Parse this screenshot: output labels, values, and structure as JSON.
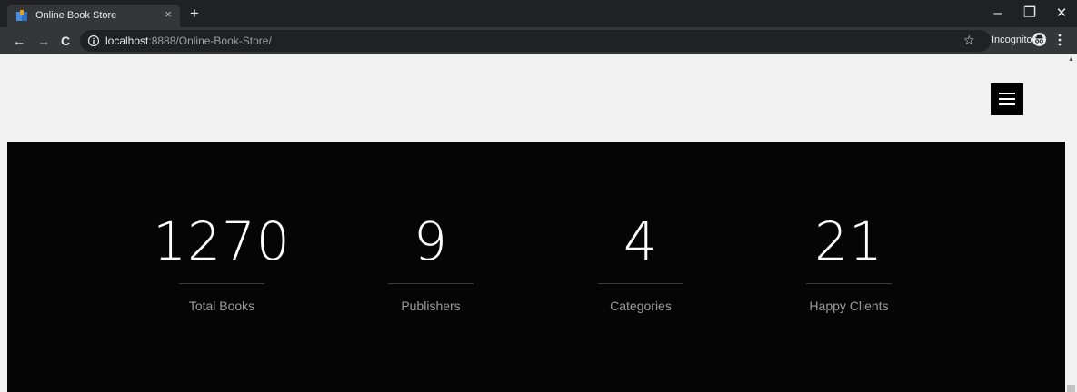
{
  "browser": {
    "tab_title": "Online Book Store",
    "tab_close": "×",
    "new_tab": "+",
    "url_host": "localhost",
    "url_rest": ":8888/Online-Book-Store/",
    "incognito_label": "Incognito",
    "window_controls": {
      "minimize": "–",
      "maximize": "❐",
      "close": "✕"
    },
    "nav": {
      "back": "←",
      "forward": "→",
      "reload": "C"
    },
    "star": "☆",
    "favicon_colors": {
      "book": "#4a8fdf",
      "leaf": "#e8a21a"
    }
  },
  "page": {
    "menu_icon": "hamburger-icon",
    "stats_background": "#050505",
    "stats": [
      {
        "value": "1270",
        "label": "Total Books"
      },
      {
        "value": "9",
        "label": "Publishers"
      },
      {
        "value": "4",
        "label": "Categories"
      },
      {
        "value": "21",
        "label": "Happy Clients"
      }
    ]
  }
}
